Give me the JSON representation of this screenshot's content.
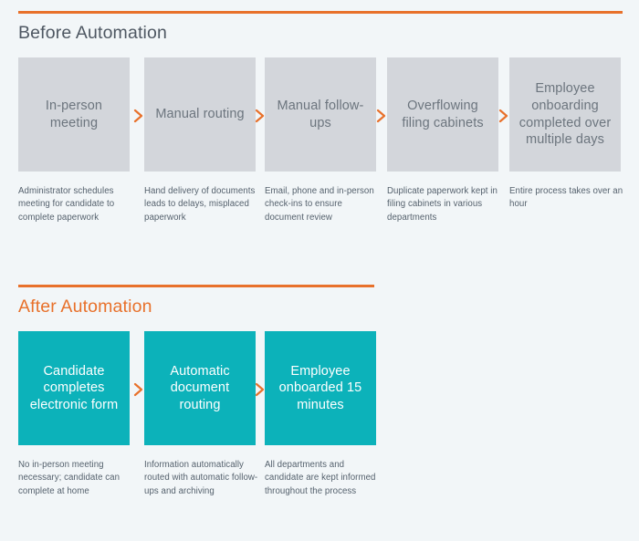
{
  "theme": {
    "background": "#f2f6f8",
    "accent_orange": "#e8712b",
    "box_gray": "#d3d6db",
    "box_teal": "#0cb2ba",
    "heading_gray": "#4e5762",
    "caption_gray": "#55616d"
  },
  "sections": [
    {
      "id": "before-automation",
      "title": "Before Automation",
      "title_color": "#4e5762",
      "box_style": "gray",
      "steps": [
        {
          "label": "In-person meeting",
          "caption": "Administrator schedules meeting for candidate to complete paperwork"
        },
        {
          "label": "Manual routing",
          "caption": "Hand delivery of documents leads to delays, misplaced paperwork"
        },
        {
          "label": "Manual follow-ups",
          "caption": "Email, phone and in-person check-ins to ensure document review"
        },
        {
          "label": "Overflowing filing cabinets",
          "caption": "Duplicate paperwork kept in filing cabinets in various departments"
        },
        {
          "label": "Employee onboarding completed over multiple days",
          "caption": "Entire process takes over an hour"
        }
      ]
    },
    {
      "id": "after-automation",
      "title": "After Automation",
      "title_color": "#e8712b",
      "box_style": "teal",
      "steps": [
        {
          "label": "Candidate completes electronic form",
          "caption": "No in-person meeting necessary; candidate can complete at home"
        },
        {
          "label": "Automatic document routing",
          "caption": "Information automatically routed with automatic follow-ups and archiving"
        },
        {
          "label": "Employee onboarded 15 minutes",
          "caption": "All departments and candidate are kept informed throughout the process"
        }
      ]
    }
  ],
  "icons": {
    "arrow": "chevron-right-icon"
  }
}
